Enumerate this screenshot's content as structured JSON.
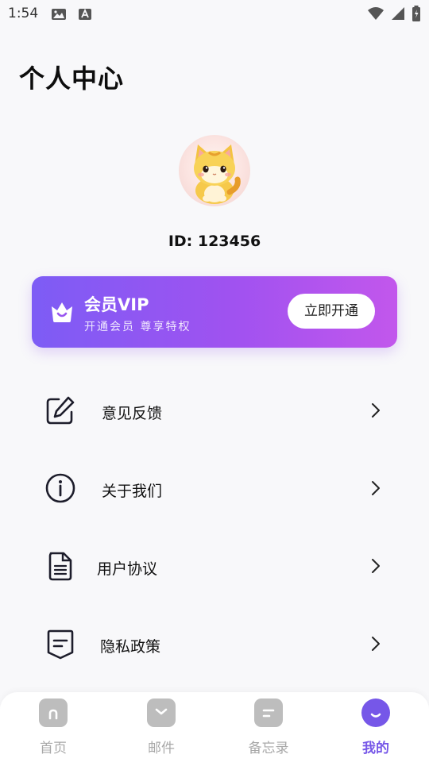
{
  "status_bar": {
    "time": "1:54"
  },
  "page": {
    "title": "个人中心"
  },
  "profile": {
    "id_text": "ID: 123456"
  },
  "vip": {
    "title": "会员VIP",
    "subtitle": "开通会员 尊享特权",
    "button_label": "立即开通"
  },
  "menu": {
    "items": [
      {
        "label": "意见反馈",
        "icon": "edit-icon"
      },
      {
        "label": "关于我们",
        "icon": "info-icon"
      },
      {
        "label": "用户协议",
        "icon": "document-icon"
      },
      {
        "label": "隐私政策",
        "icon": "policy-icon"
      }
    ]
  },
  "bottom_nav": {
    "tabs": [
      {
        "label": "首页",
        "icon": "home-icon",
        "active": false
      },
      {
        "label": "邮件",
        "icon": "mail-icon",
        "active": false
      },
      {
        "label": "备忘录",
        "icon": "memo-icon",
        "active": false
      },
      {
        "label": "我的",
        "icon": "profile-icon",
        "active": true
      }
    ]
  },
  "colors": {
    "accent": "#7657e8",
    "vip_gradient_start": "#7d5cf5",
    "vip_gradient_end": "#c257ec",
    "inactive_nav": "#a8a8a8"
  }
}
